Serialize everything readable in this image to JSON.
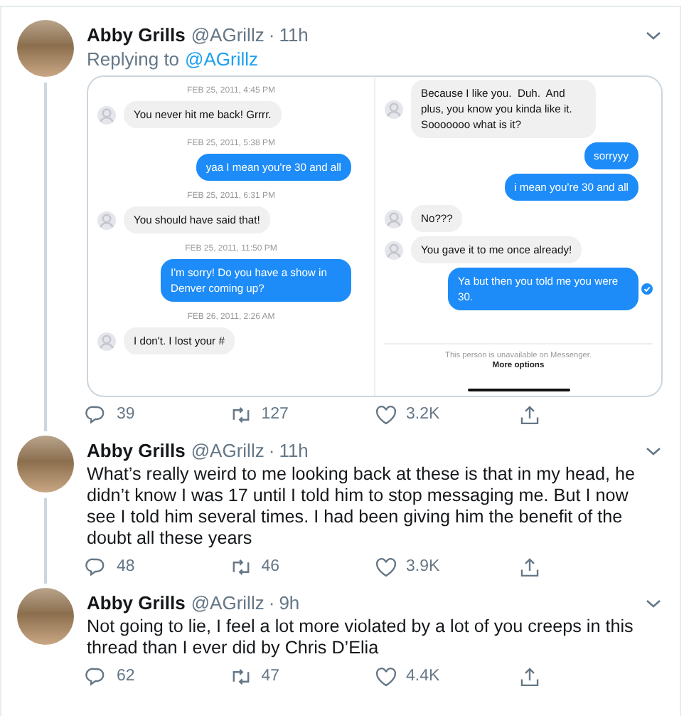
{
  "tweets": [
    {
      "name": "Abby Grills",
      "handle": "@AGrillz",
      "separator": "·",
      "time": "11h",
      "connected": true,
      "replying_label": "Replying to",
      "replying_to": "@AGrillz",
      "image": {
        "panels": [
          {
            "items": [
              {
                "kind": "time",
                "text": "FEB 25, 2011, 4:45 PM"
              },
              {
                "kind": "received",
                "text": "You never hit me back! Grrrr."
              },
              {
                "kind": "time",
                "text": "FEB 25, 2011, 5:38 PM"
              },
              {
                "kind": "sent",
                "text": "yaa I mean you're 30 and all"
              },
              {
                "kind": "time",
                "text": "FEB 25, 2011, 6:31 PM"
              },
              {
                "kind": "received",
                "text": "You should have said that!"
              },
              {
                "kind": "time",
                "text": "FEB 25, 2011, 11:50 PM"
              },
              {
                "kind": "sent",
                "text": "I'm sorry! Do you have a show in Denver coming up?"
              },
              {
                "kind": "time",
                "text": "FEB 26, 2011, 2:26 AM"
              },
              {
                "kind": "received",
                "text": "I don't. I lost your #"
              }
            ]
          },
          {
            "items": [
              {
                "kind": "received",
                "text": "Because I like you.  Duh.  And plus, you know you kinda like it. Sooooooo what is it?"
              },
              {
                "kind": "sent",
                "text": "sorryyy"
              },
              {
                "kind": "sent",
                "text": "i mean you're 30 and all"
              },
              {
                "kind": "received",
                "text": "No???"
              },
              {
                "kind": "received",
                "text": "You gave it to me once already!"
              },
              {
                "kind": "sent",
                "text": "Ya but then you told me you were 30.",
                "seen": true
              }
            ],
            "notice": "This person is unavailable on Messenger.",
            "notice_link": "More options"
          }
        ]
      },
      "actions": {
        "replies": "39",
        "retweets": "127",
        "likes": "3.2K"
      }
    },
    {
      "name": "Abby Grills",
      "handle": "@AGrillz",
      "separator": "·",
      "time": "11h",
      "connected": true,
      "text": "What’s really weird to me looking back at these is that in my head, he didn’t know I was 17 until I told him to stop messaging me. But I now see I told him several times. I had been giving him the benefit of the doubt all these years",
      "actions": {
        "replies": "48",
        "retweets": "46",
        "likes": "3.9K"
      }
    },
    {
      "name": "Abby Grills",
      "handle": "@AGrillz",
      "separator": "·",
      "time": "9h",
      "connected": false,
      "text": "Not going to lie, I feel a lot more violated by a lot of you creeps in this thread than I ever did by Chris D’Elia",
      "actions": {
        "replies": "62",
        "retweets": "47",
        "likes": "4.4K"
      }
    }
  ]
}
